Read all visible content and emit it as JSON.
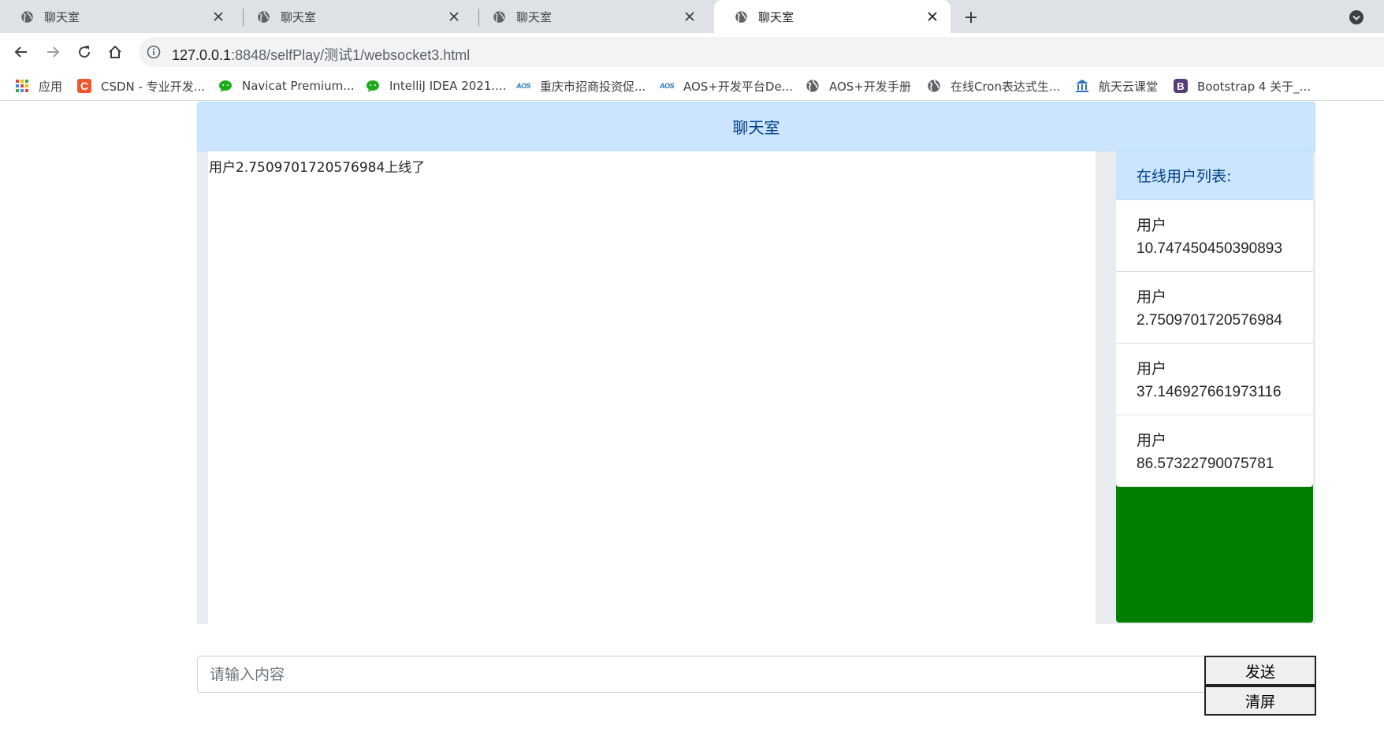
{
  "browser": {
    "tabs": [
      {
        "title": "聊天室",
        "active": false
      },
      {
        "title": "聊天室",
        "active": false
      },
      {
        "title": "聊天室",
        "active": false
      },
      {
        "title": "聊天室",
        "active": true
      }
    ],
    "address": {
      "host": "127.0.0.1",
      "path": ":8848/selfPlay/测试1/websocket3.html"
    },
    "bookmarks": [
      {
        "label": "应用",
        "icon": "apps-grid-icon"
      },
      {
        "label": "CSDN - 专业开发...",
        "icon": "csdn-icon"
      },
      {
        "label": "Navicat Premium...",
        "icon": "wechat-icon"
      },
      {
        "label": "IntelliJ IDEA 2021....",
        "icon": "wechat-icon"
      },
      {
        "label": "重庆市招商投资促...",
        "icon": "aos-icon"
      },
      {
        "label": "AOS+开发平台De...",
        "icon": "aos-icon"
      },
      {
        "label": "AOS+开发手册",
        "icon": "globe-icon"
      },
      {
        "label": "在线Cron表达式生...",
        "icon": "globe-icon"
      },
      {
        "label": "航天云课堂",
        "icon": "bank-icon"
      },
      {
        "label": "Bootstrap 4 关于_...",
        "icon": "bootstrap-icon"
      }
    ]
  },
  "chat": {
    "header": "聊天室",
    "messages": [
      "用户2.7509701720576984上线了"
    ],
    "online_users_title": "在线用户列表:",
    "online_users": [
      {
        "label": "用户",
        "id": "10.747450450390893"
      },
      {
        "label": "用户",
        "id": "2.7509701720576984"
      },
      {
        "label": "用户",
        "id": "37.146927661973116"
      },
      {
        "label": "用户",
        "id": "86.57322790075781"
      }
    ],
    "input_placeholder": "请输入内容",
    "send_label": "发送",
    "clear_label": "清屏"
  },
  "colors": {
    "header_bg": "#cce5ff",
    "header_text": "#004085",
    "user_panel_bg": "#008000"
  }
}
